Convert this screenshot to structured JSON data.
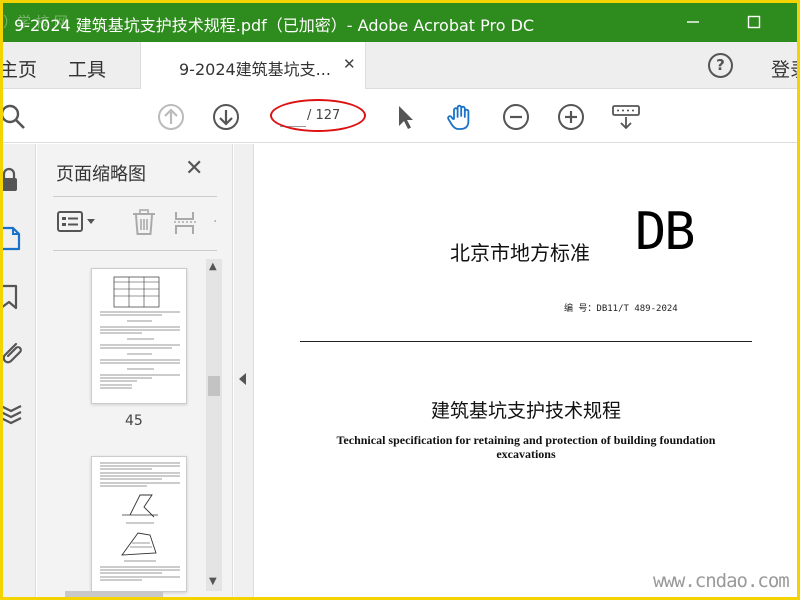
{
  "window": {
    "title": "9-2024 建筑基坑支护技术规程.pdf（已加密）- Adobe Acrobat Pro DC",
    "logo_text": "）学 校 网"
  },
  "tabs": {
    "home_label": "主页",
    "tools_label": "工具",
    "doc_tab_label": "9-2024建筑基坑支...",
    "login_label": "登录"
  },
  "toolbar": {
    "page_value": "",
    "page_total": "/ 127"
  },
  "thumbnails": {
    "title": "页面缩略图",
    "pages": [
      {
        "number": "45"
      },
      {
        "number": ""
      }
    ]
  },
  "document": {
    "standard_label": "北京市地方标准",
    "db_mark": "DB",
    "code": "编  号：DB11/T 489-2024",
    "cn_title": "建筑基坑支护技术规程",
    "en_title": "Technical specification for retaining and protection of building foundation excavations"
  },
  "watermark": "www.cndao.com",
  "colors": {
    "titlebar": "#2e8b1d",
    "border": "#f4d400",
    "accent_blue": "#1a73c9",
    "annotation_red": "#d11111"
  }
}
